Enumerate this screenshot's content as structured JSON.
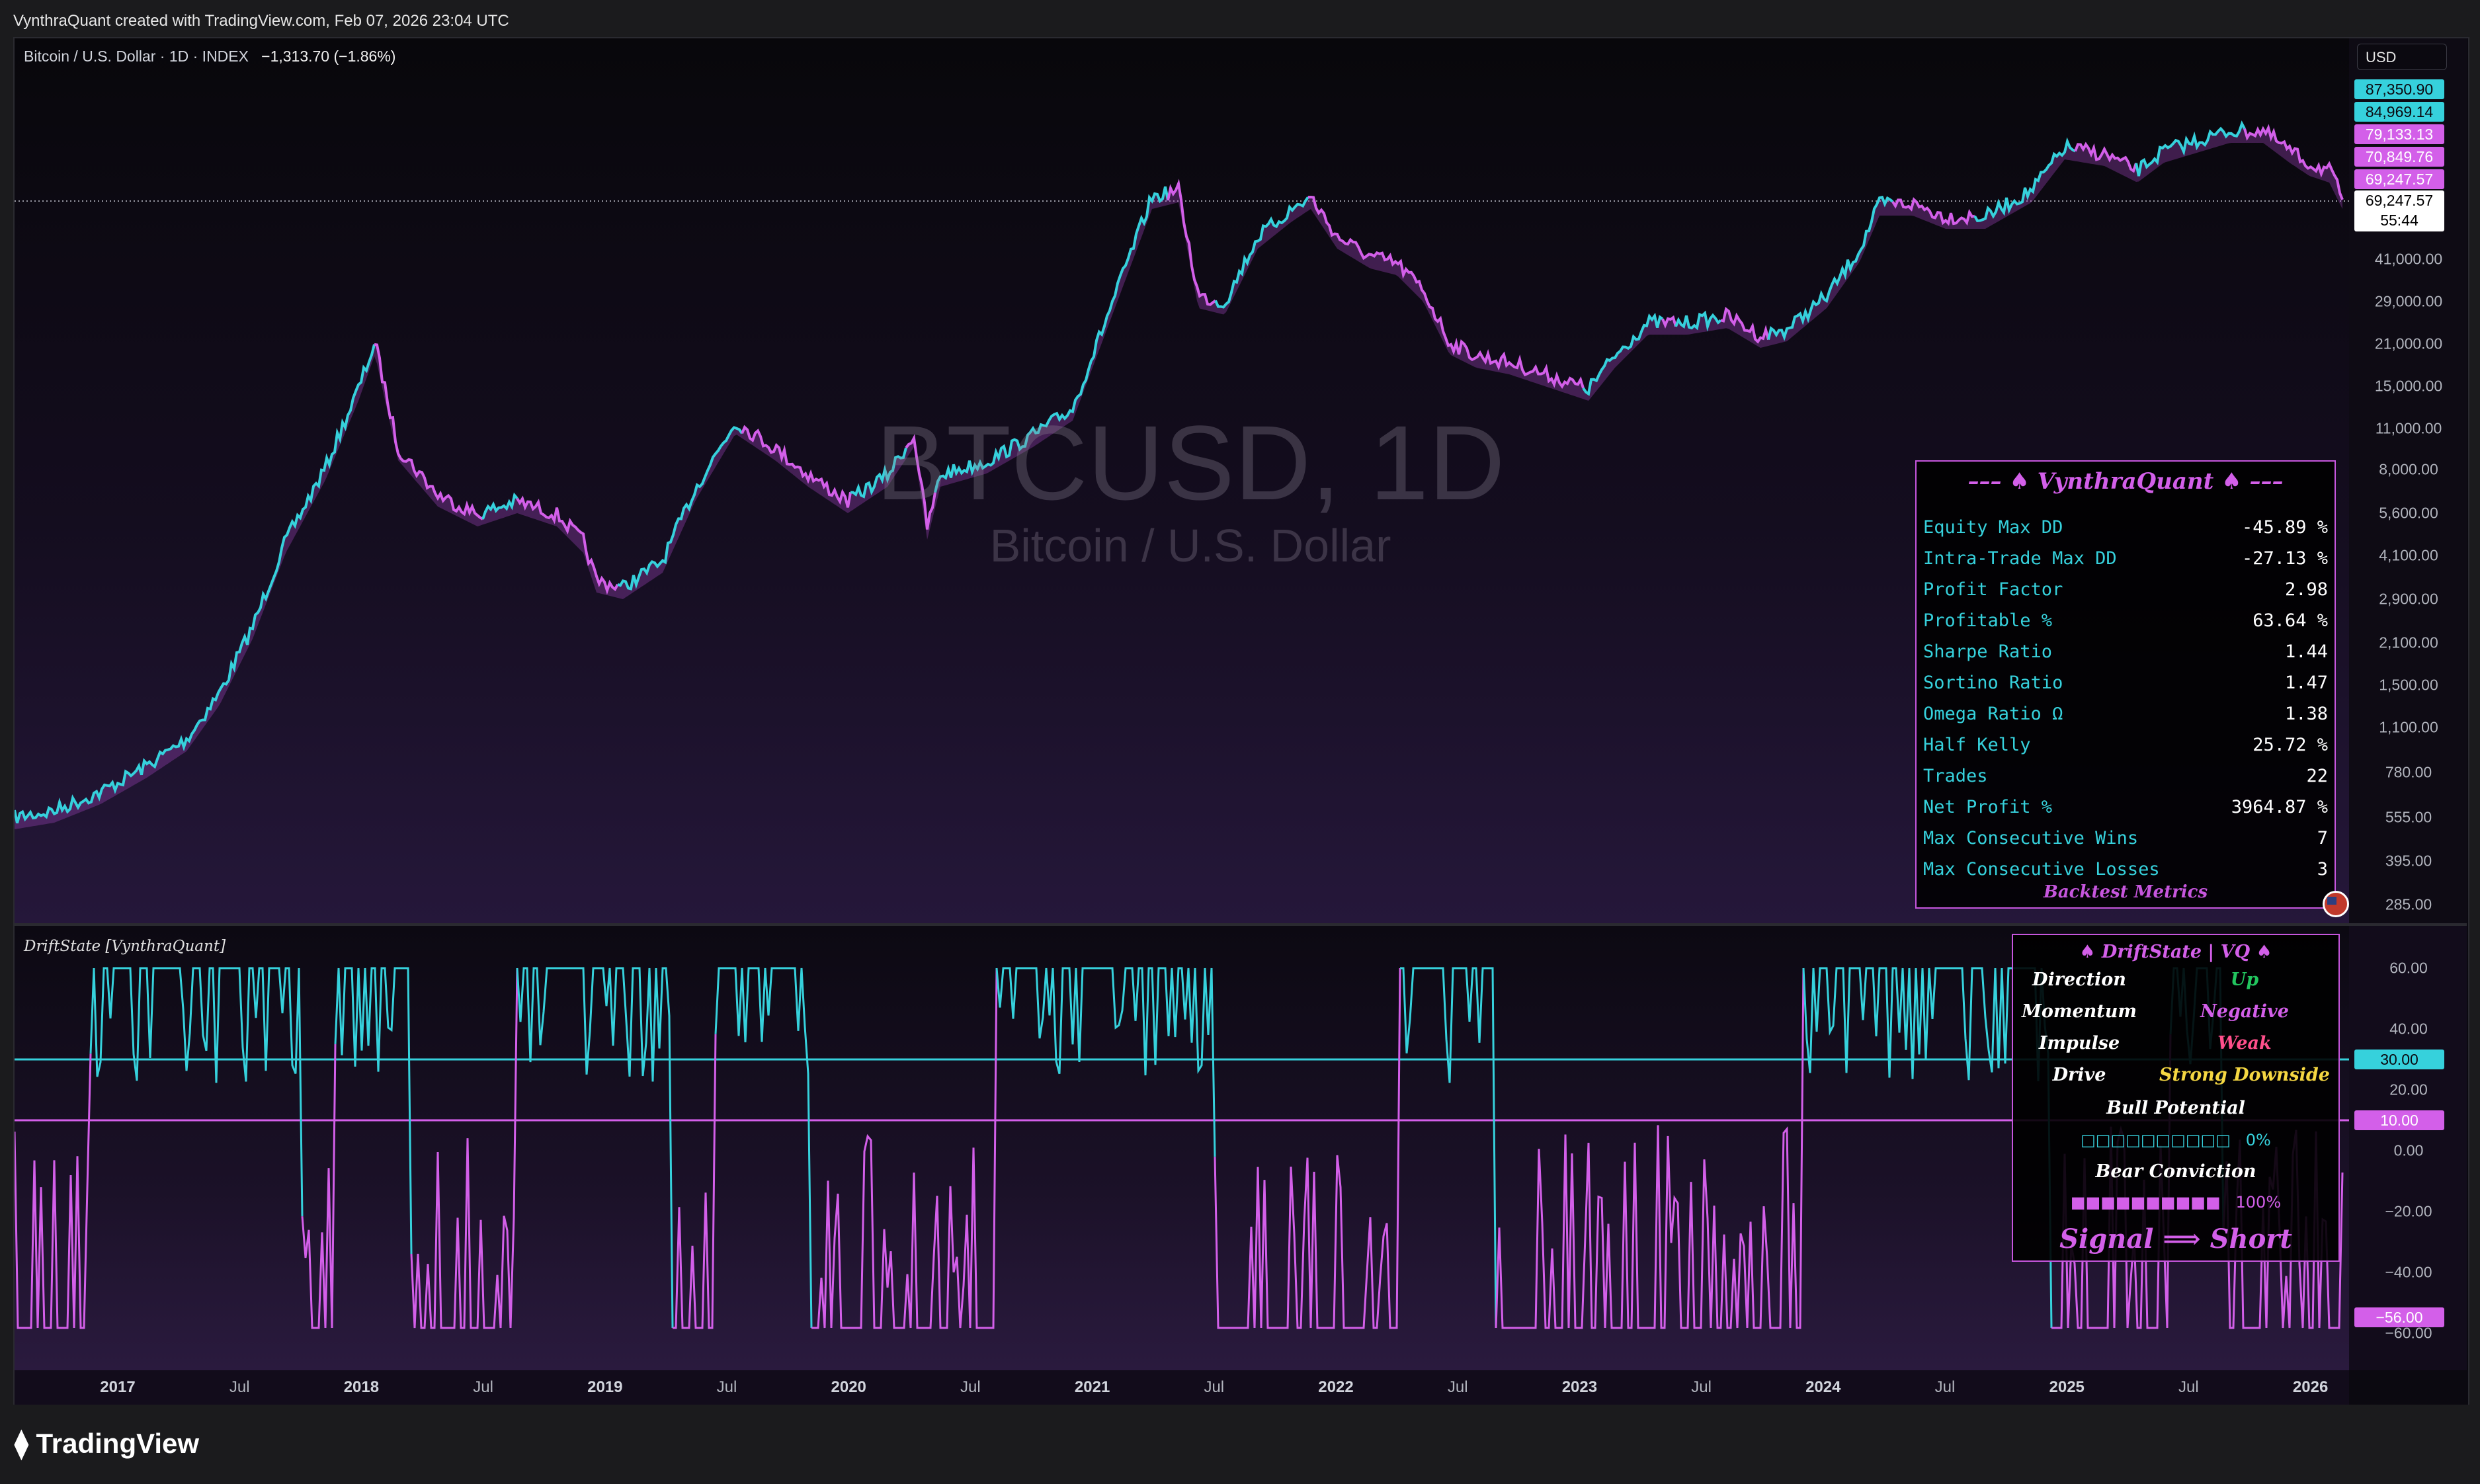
{
  "header": {
    "credit": "VynthraQuant created with TradingView.com, Feb 07, 2026 23:04 UTC"
  },
  "legend": {
    "symbol": "Bitcoin / U.S. Dollar · 1D · INDEX",
    "change": "−1,313.70 (−1.86%)"
  },
  "watermark": {
    "symbol": "BTCUSD, 1D",
    "name": "Bitcoin / U.S. Dollar"
  },
  "price_axis": {
    "currency": "USD",
    "labels": [
      "41,000.00",
      "29,000.00",
      "21,000.00",
      "15,000.00",
      "11,000.00",
      "8,000.00",
      "5,600.00",
      "4,100.00",
      "2,900.00",
      "2,100.00",
      "1,500.00",
      "1,100.00",
      "780.00",
      "555.00",
      "395.00",
      "285.00"
    ],
    "tags": [
      {
        "text": "87,350.90",
        "bg": "#36d1dc",
        "fg": "#0b0910"
      },
      {
        "text": "84,969.14",
        "bg": "#36d1dc",
        "fg": "#0b0910"
      },
      {
        "text": "79,133.13",
        "bg": "#d35fe9",
        "fg": "#ffffff"
      },
      {
        "text": "70,849.76",
        "bg": "#d35fe9",
        "fg": "#ffffff"
      },
      {
        "text": "69,247.57",
        "bg": "#d35fe9",
        "fg": "#ffffff"
      }
    ],
    "last_price": "69,247.57",
    "countdown": "55:44"
  },
  "indicator": {
    "title": "DriftState [VynthraQuant]"
  },
  "osc_axis": {
    "labels": [
      "60.00",
      "40.00",
      "20.00",
      "0.00",
      "−20.00",
      "−40.00",
      "−60.00"
    ],
    "tags": [
      {
        "text": "30.00",
        "bg": "#36d1dc",
        "fg": "#0b0910"
      },
      {
        "text": "10.00",
        "bg": "#d35fe9",
        "fg": "#ffffff"
      },
      {
        "text": "−56.00",
        "bg": "#d35fe9",
        "fg": "#ffffff"
      }
    ]
  },
  "time_axis": {
    "labels": [
      {
        "t": "2017",
        "year": true
      },
      {
        "t": "Jul",
        "year": false
      },
      {
        "t": "2018",
        "year": true
      },
      {
        "t": "Jul",
        "year": false
      },
      {
        "t": "2019",
        "year": true
      },
      {
        "t": "Jul",
        "year": false
      },
      {
        "t": "2020",
        "year": true
      },
      {
        "t": "Jul",
        "year": false
      },
      {
        "t": "2021",
        "year": true
      },
      {
        "t": "Jul",
        "year": false
      },
      {
        "t": "2022",
        "year": true
      },
      {
        "t": "Jul",
        "year": false
      },
      {
        "t": "2023",
        "year": true
      },
      {
        "t": "Jul",
        "year": false
      },
      {
        "t": "2024",
        "year": true
      },
      {
        "t": "Jul",
        "year": false
      },
      {
        "t": "2025",
        "year": true
      },
      {
        "t": "Jul",
        "year": false
      },
      {
        "t": "2026",
        "year": true
      }
    ]
  },
  "backtest": {
    "title": "––– ♠ VynthraQuant ♠ –––",
    "rows": [
      {
        "k": "Equity Max DD",
        "v": "-45.89 %"
      },
      {
        "k": "Intra-Trade Max DD",
        "v": "-27.13 %"
      },
      {
        "k": "Profit Factor",
        "v": "2.98"
      },
      {
        "k": "Profitable %",
        "v": "63.64 %"
      },
      {
        "k": "Sharpe Ratio",
        "v": "1.44"
      },
      {
        "k": "Sortino Ratio",
        "v": "1.47"
      },
      {
        "k": "Omega Ratio Ω",
        "v": "1.38"
      },
      {
        "k": "Half Kelly",
        "v": "25.72 %"
      },
      {
        "k": "Trades",
        "v": "22"
      },
      {
        "k": "Net Profit %",
        "v": "3964.87 %"
      },
      {
        "k": "Max Consecutive Wins",
        "v": "7"
      },
      {
        "k": "Max Consecutive Losses",
        "v": "3"
      }
    ],
    "footer": "Backtest Metrics"
  },
  "driftstate": {
    "title": "♠ DriftState | VQ ♠",
    "rows": [
      {
        "k": "Direction",
        "v": "Up",
        "color": "#22c55e"
      },
      {
        "k": "Momentum",
        "v": "Negative",
        "color": "#d35fe9"
      },
      {
        "k": "Impulse",
        "v": "Weak",
        "color": "#ff4f8b"
      },
      {
        "k": "Drive",
        "v": "Strong Downside",
        "color": "#f5d742"
      }
    ],
    "bull_label": "Bull Potential",
    "bull_bar": "□□□□□□□□□□",
    "bull_pct": "0%",
    "bull_value": 0,
    "bear_label": "Bear Conviction",
    "bear_bar": "■■■■■■■■■■",
    "bear_pct": "100%",
    "bear_value": 100,
    "signal": "Signal  ⟹  Short"
  },
  "brand": {
    "logo": "TradingView"
  },
  "colors": {
    "bull": "#36d1dc",
    "bear": "#d35fe9"
  }
}
